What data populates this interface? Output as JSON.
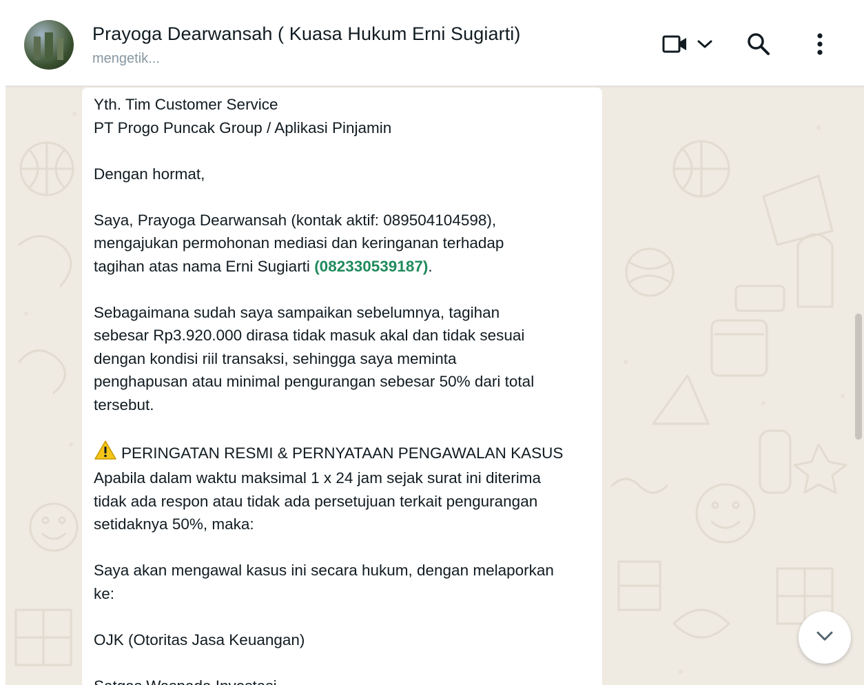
{
  "header": {
    "contact_name": "Prayoga Dearwansah ( Kuasa Hukum Erni Sugiarti)",
    "status": "mengetik...",
    "icons": [
      "video-camera-icon",
      "chevron-down-icon",
      "search-icon",
      "more-vertical-icon"
    ]
  },
  "message": {
    "line_1": "Yth. Tim Customer Service",
    "line_2": "PT Progo Puncak Group / Aplikasi Pinjamin",
    "greeting": "Dengan hormat,",
    "para_1_a": "Saya, Prayoga Dearwansah (kontak aktif: 089504104598),",
    "para_1_b": "mengajukan permohonan mediasi dan keringanan terhadap",
    "para_1_c": "tagihan atas nama Erni Sugiarti ",
    "para_1_phone": "(082330539187)",
    "para_1_end": ".",
    "para_2_a": "Sebagaimana sudah saya sampaikan sebelumnya, tagihan",
    "para_2_b": "sebesar Rp3.920.000 dirasa tidak masuk akal dan tidak sesuai",
    "para_2_c": "dengan kondisi riil transaksi, sehingga saya meminta",
    "para_2_d": "penghapusan atau minimal pengurangan sebesar 50% dari total",
    "para_2_e": "tersebut.",
    "warning_title": "PERINGATAN RESMI & PERNYATAAN PENGAWALAN KASUS",
    "para_3_a": "Apabila dalam waktu maksimal 1 x 24 jam sejak surat ini diterima",
    "para_3_b": "tidak ada respon atau tidak ada persetujuan terkait pengurangan",
    "para_3_c": "setidaknya 50%, maka:",
    "para_4_a": "Saya akan mengawal kasus ini secara hukum, dengan melaporkan",
    "para_4_b": "ke:",
    "item_1": "OJK (Otoritas Jasa Keuangan)",
    "item_2": "Satgas Waspada Investasi"
  },
  "colors": {
    "chat_background": "#efeae2",
    "bubble": "#ffffff",
    "phone_link": "#1f8a5b",
    "warning": "#f5c518"
  }
}
